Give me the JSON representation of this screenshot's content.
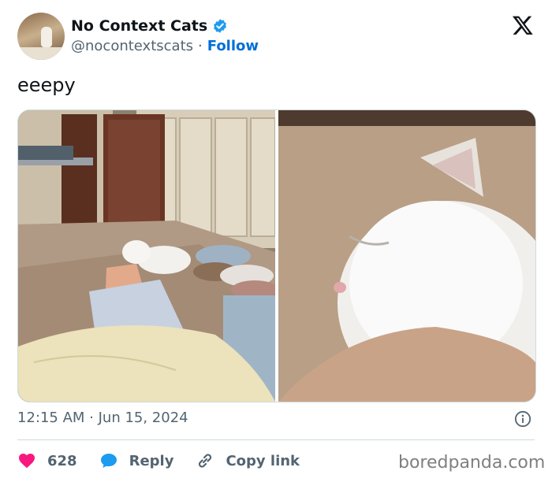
{
  "author": {
    "display_name": "No Context Cats",
    "handle": "@nocontextscats",
    "separator": "·",
    "follow_label": "Follow",
    "verified_icon": "verified-badge-icon",
    "verified_color": "#1d9bf0"
  },
  "platform_icon": "x-logo-icon",
  "tweet": {
    "text": "eeepy"
  },
  "media": {
    "photos": [
      {
        "subject": "cat-on-bed-photo"
      },
      {
        "subject": "cat-closeup-photo"
      }
    ]
  },
  "meta": {
    "timestamp": "12:15 AM · Jun 15, 2024",
    "info_icon": "info-icon"
  },
  "actions": {
    "like_count": "628",
    "like_color": "#f91880",
    "reply_label": "Reply",
    "reply_color": "#1d9bf0",
    "copy_label": "Copy link"
  },
  "watermark": "boredpanda.com"
}
